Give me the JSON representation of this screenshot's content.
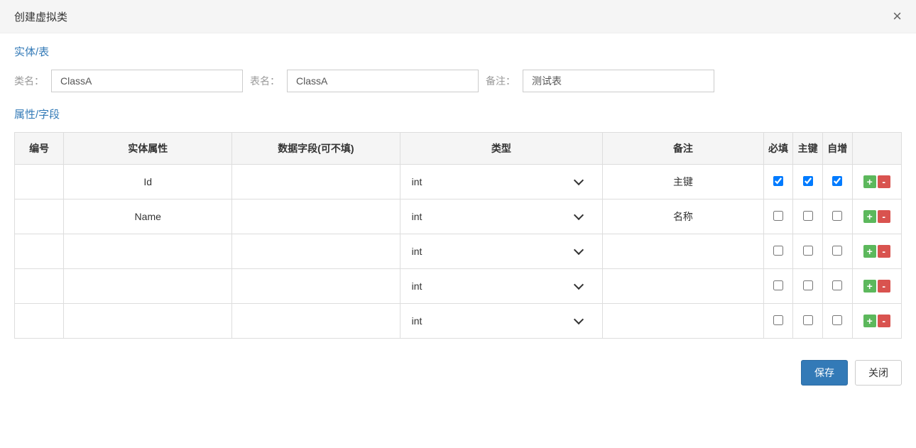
{
  "header": {
    "title": "创建虚拟类"
  },
  "sections": {
    "entity": "实体/表",
    "fields": "属性/字段"
  },
  "form": {
    "class_label": "类名：",
    "class_value": "ClassA",
    "table_label": "表名：",
    "table_value": "ClassA",
    "remark_label": "备注：",
    "remark_value": "测试表"
  },
  "table": {
    "headers": {
      "no": "编号",
      "attr": "实体属性",
      "field": "数据字段(可不填)",
      "type": "类型",
      "remark": "备注",
      "required": "必填",
      "pk": "主键",
      "auto": "自增"
    },
    "rows": [
      {
        "no": "",
        "attr": "Id",
        "field": "",
        "type": "int",
        "remark": "主键",
        "required": true,
        "pk": true,
        "auto": true
      },
      {
        "no": "",
        "attr": "Name",
        "field": "",
        "type": "int",
        "remark": "名称",
        "required": false,
        "pk": false,
        "auto": false
      },
      {
        "no": "",
        "attr": "",
        "field": "",
        "type": "int",
        "remark": "",
        "required": false,
        "pk": false,
        "auto": false
      },
      {
        "no": "",
        "attr": "",
        "field": "",
        "type": "int",
        "remark": "",
        "required": false,
        "pk": false,
        "auto": false
      },
      {
        "no": "",
        "attr": "",
        "field": "",
        "type": "int",
        "remark": "",
        "required": false,
        "pk": false,
        "auto": false
      }
    ]
  },
  "footer": {
    "save": "保存",
    "close": "关闭"
  },
  "icons": {
    "add": "+",
    "remove": "-"
  }
}
